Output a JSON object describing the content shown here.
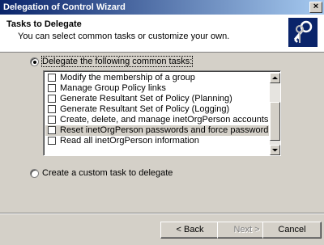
{
  "window": {
    "title": "Delegation of Control Wizard",
    "close_label": "×"
  },
  "header": {
    "title": "Tasks to Delegate",
    "subtitle": "You can select common tasks or customize your own."
  },
  "options": {
    "common": {
      "label": "Delegate the following common tasks:",
      "selected": true
    },
    "custom": {
      "label": "Create a custom task to delegate",
      "selected": false
    }
  },
  "tasks": [
    {
      "label": "Modify the membership of a group",
      "checked": false
    },
    {
      "label": "Manage Group Policy links",
      "checked": false
    },
    {
      "label": "Generate Resultant Set of Policy (Planning)",
      "checked": false
    },
    {
      "label": "Generate Resultant Set of Policy (Logging)",
      "checked": false
    },
    {
      "label": "Create, delete, and manage inetOrgPerson accounts",
      "checked": false
    },
    {
      "label": "Reset inetOrgPerson passwords and force password change at ne...",
      "checked": false,
      "selected": true
    },
    {
      "label": "Read all inetOrgPerson information",
      "checked": false
    }
  ],
  "buttons": {
    "back": "< Back",
    "next": "Next >",
    "cancel": "Cancel"
  },
  "colors": {
    "titlebar_start": "#0a246a",
    "titlebar_end": "#a6caf0",
    "face": "#d4d0c8"
  }
}
